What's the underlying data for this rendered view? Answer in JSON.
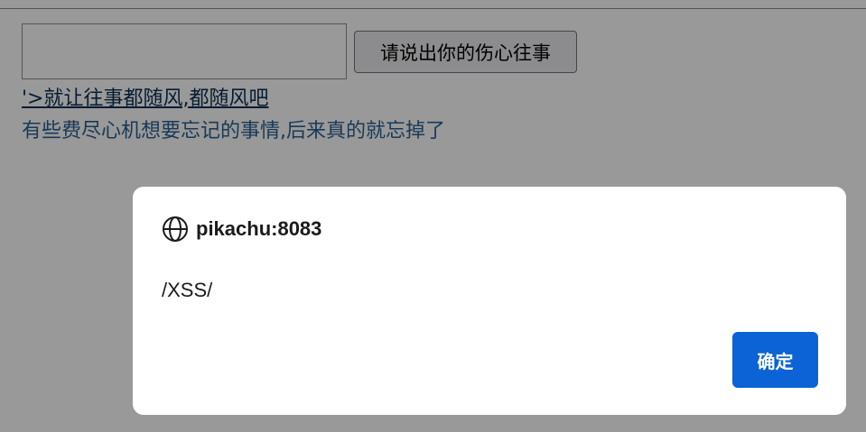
{
  "page": {
    "input_value": "",
    "submit_label": "请说出你的伤心往事",
    "result_link": "'>就让往事都随风,都随风吧",
    "message": "有些费尽心机想要忘记的事情,后来真的就忘掉了"
  },
  "dialog": {
    "origin_icon": "globe-icon",
    "origin": "pikachu:8083",
    "message": "/XSS/",
    "ok_label": "确定"
  },
  "colors": {
    "link": "#0a2d55",
    "message_text": "#2c5f93",
    "ok_button": "#0b63d6",
    "overlay": "rgba(0,0,0,0.40)"
  }
}
